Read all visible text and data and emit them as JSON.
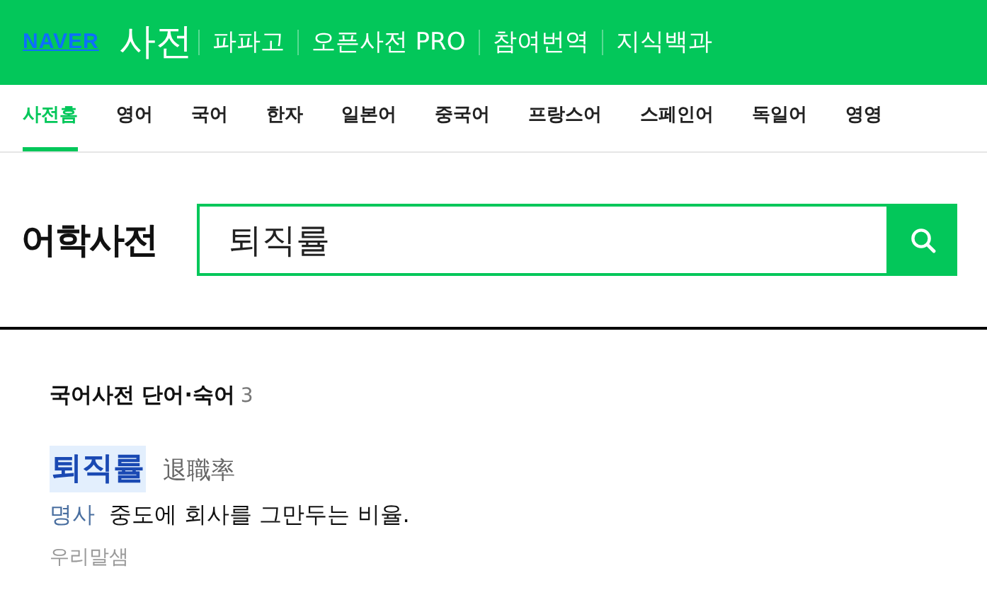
{
  "header": {
    "logo": "NAVER",
    "service": "사전",
    "links": [
      "파파고",
      "오픈사전 PRO",
      "참여번역",
      "지식백과"
    ]
  },
  "tabs": [
    {
      "label": "사전홈",
      "selected": true
    },
    {
      "label": "영어",
      "selected": false
    },
    {
      "label": "국어",
      "selected": false
    },
    {
      "label": "한자",
      "selected": false
    },
    {
      "label": "일본어",
      "selected": false
    },
    {
      "label": "중국어",
      "selected": false
    },
    {
      "label": "프랑스어",
      "selected": false
    },
    {
      "label": "스페인어",
      "selected": false
    },
    {
      "label": "독일어",
      "selected": false
    },
    {
      "label": "영영",
      "selected": false
    }
  ],
  "search": {
    "title": "어학사전",
    "value": "퇴직률"
  },
  "section": {
    "title": "국어사전 단어·숙어",
    "count": "3"
  },
  "entries": [
    {
      "word": "퇴직률",
      "hanja": "退職率",
      "pos": "명사",
      "definition": "중도에 회사를 그만두는 비율.",
      "source": "우리말샘"
    }
  ]
}
